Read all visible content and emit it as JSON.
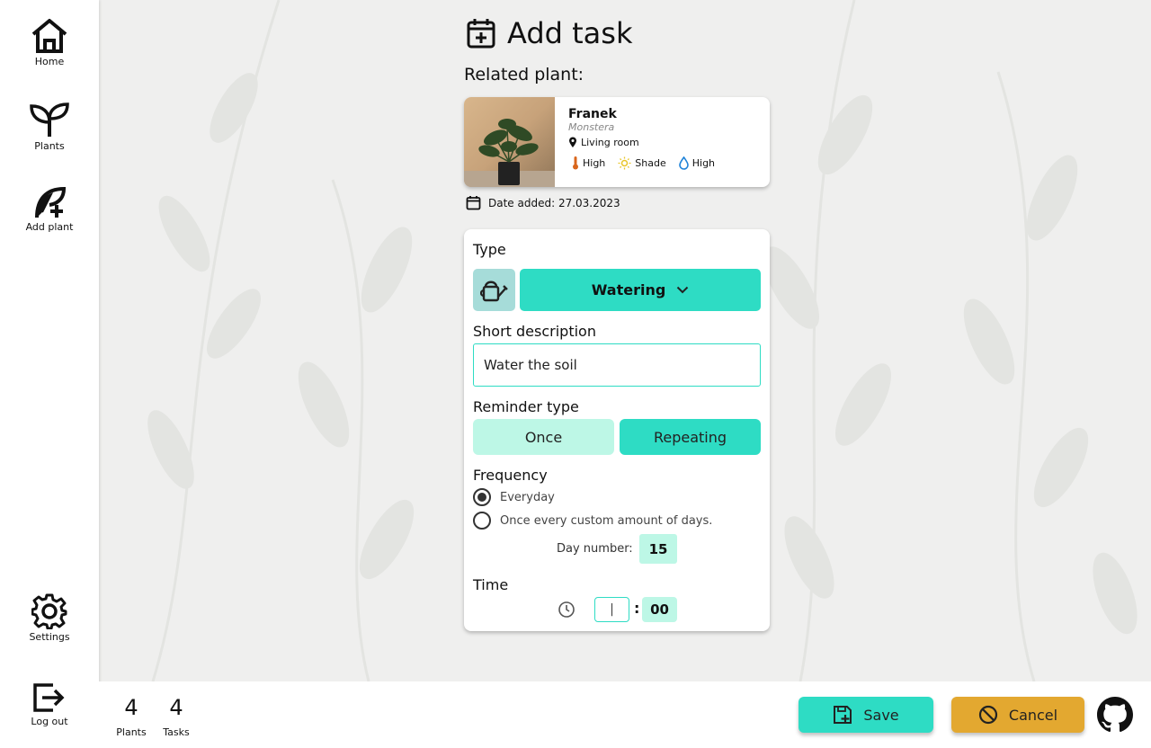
{
  "sidebar": {
    "items": [
      {
        "label": "Home",
        "icon": "home-icon"
      },
      {
        "label": "Plants",
        "icon": "sprout-icon"
      },
      {
        "label": "Add plant",
        "icon": "add-plant-icon"
      },
      {
        "label": "Settings",
        "icon": "gear-icon"
      },
      {
        "label": "Log out",
        "icon": "logout-icon"
      }
    ]
  },
  "page": {
    "title": "Add task",
    "related_label": "Related plant:"
  },
  "plant": {
    "name": "Franek",
    "species": "Monstera",
    "location": "Living room",
    "temperature": "High",
    "light": "Shade",
    "humidity": "High",
    "date_added": "Date added: 27.03.2023"
  },
  "form": {
    "type_label": "Type",
    "type_value": "Watering",
    "desc_label": "Short description",
    "desc_value": "Water the soil",
    "reminder_label": "Reminder type",
    "reminder_once": "Once",
    "reminder_repeating": "Repeating",
    "frequency_label": "Frequency",
    "freq_everyday": "Everyday",
    "freq_custom": "Once every custom amount of days.",
    "day_number_label": "Day number:",
    "day_number_value": "15",
    "time_label": "Time",
    "hour_value": "|",
    "minute_value": "00"
  },
  "footer": {
    "plants_count": "4",
    "plants_label": "Plants",
    "tasks_count": "4",
    "tasks_label": "Tasks",
    "save_label": "Save",
    "cancel_label": "Cancel"
  },
  "colors": {
    "accent": "#2edcc4",
    "accent_light": "#bdf7e6",
    "cancel": "#e3a830",
    "background": "#efefee"
  }
}
